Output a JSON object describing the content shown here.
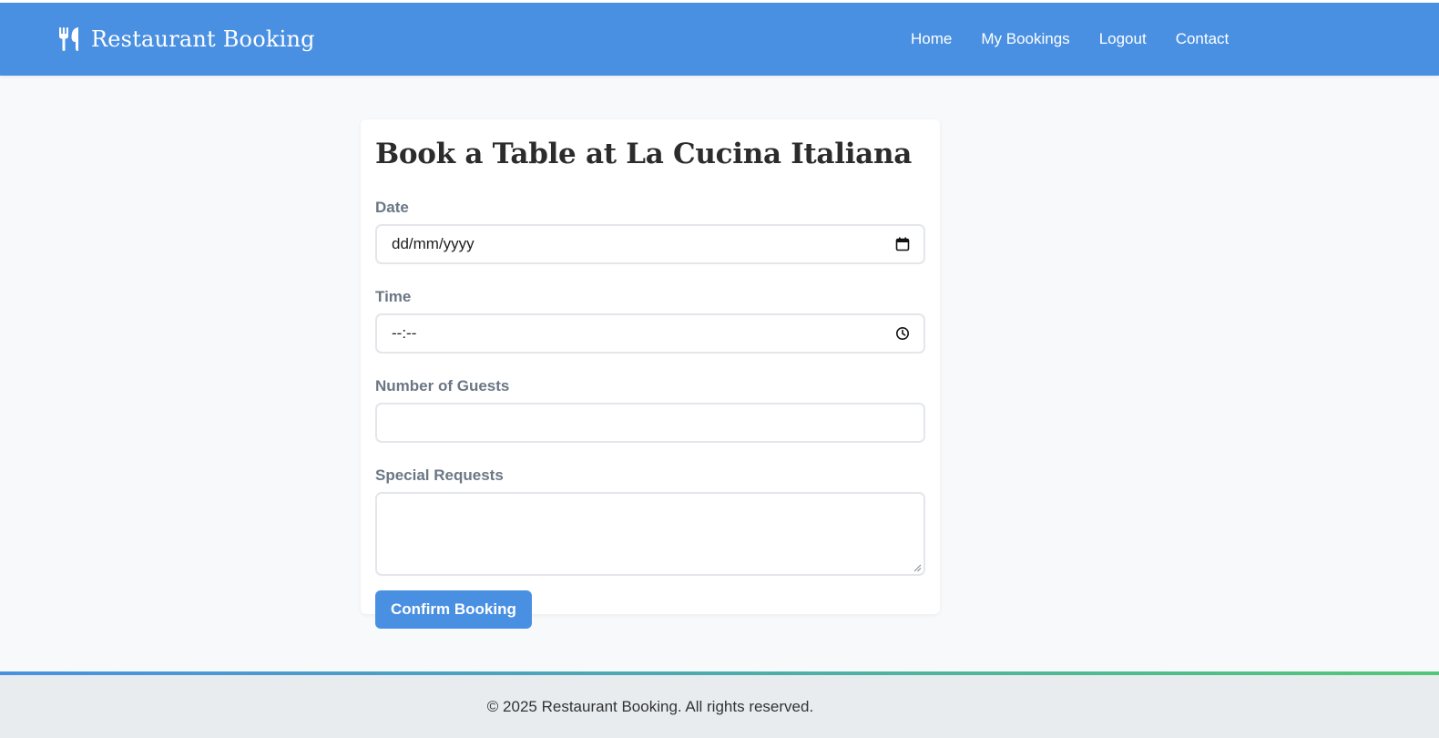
{
  "header": {
    "brand_icon": "utensils-icon",
    "brand_name": "Restaurant Booking",
    "accent_color": "#4a90e2",
    "nav": [
      "Home",
      "My Bookings",
      "Logout",
      "Contact"
    ]
  },
  "form": {
    "title": "Book a Table at La Cucina Italiana",
    "date": {
      "label": "Date",
      "value": "dd/mm/yyyy",
      "icon": "calendar-icon"
    },
    "time": {
      "label": "Time",
      "value": "--:--",
      "icon": "clock-icon"
    },
    "guests": {
      "label": "Number of Guests",
      "value": ""
    },
    "requests": {
      "label": "Special Requests",
      "value": ""
    },
    "submit_label": "Confirm Booking"
  },
  "footer": {
    "text": "© 2025 Restaurant Booking. All rights reserved."
  }
}
